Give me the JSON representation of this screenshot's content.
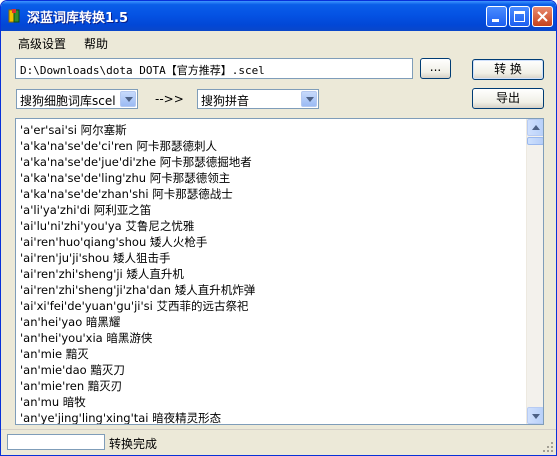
{
  "window": {
    "title": "深蓝词库转换1.5",
    "icon": "book-icon"
  },
  "menu": [
    "高级设置",
    "帮助"
  ],
  "path_input": {
    "value": "D:\\Downloads\\dota DOTA【官方推荐】.scel"
  },
  "buttons": {
    "browse": "...",
    "convert": "转 换",
    "export": "导出"
  },
  "source_format": {
    "selected": "搜狗细胞词库scel"
  },
  "arrow_label": "-->>",
  "target_format": {
    "selected": "搜狗拼音"
  },
  "output_lines": [
    "'a'er'sai'si 阿尔塞斯",
    "'a'ka'na'se'de'ci'ren 阿卡那瑟德刺人",
    "'a'ka'na'se'de'jue'di'zhe 阿卡那瑟德掘地者",
    "'a'ka'na'se'de'ling'zhu 阿卡那瑟德领主",
    "'a'ka'na'se'de'zhan'shi 阿卡那瑟德战士",
    "'a'li'ya'zhi'di 阿利亚之笛",
    "'ai'lu'ni'zhi'you'ya 艾鲁尼之忧雅",
    "'ai'ren'huo'qiang'shou 矮人火枪手",
    "'ai'ren'ju'ji'shou 矮人狙击手",
    "'ai'ren'zhi'sheng'ji 矮人直升机",
    "'ai'ren'zhi'sheng'ji'zha'dan 矮人直升机炸弹",
    "'ai'xi'fei'de'yuan'gu'ji'si 艾西菲的远古祭祀",
    "'an'hei'yao 暗黑耀",
    "'an'hei'you'xia 暗黑游侠",
    "'an'mie 黯灭",
    "'an'mie'dao 黯灭刀",
    "'an'mie'ren 黯灭刃",
    "'an'mu 暗牧",
    "'an'ye'jing'ling'xing'tai 暗夜精灵形态"
  ],
  "status": {
    "text": "转换完成",
    "progress": 0
  },
  "colors": {
    "title_bar": "#0553e4",
    "window_bg": "#ece9d8",
    "progress": "#2d9b3c"
  }
}
